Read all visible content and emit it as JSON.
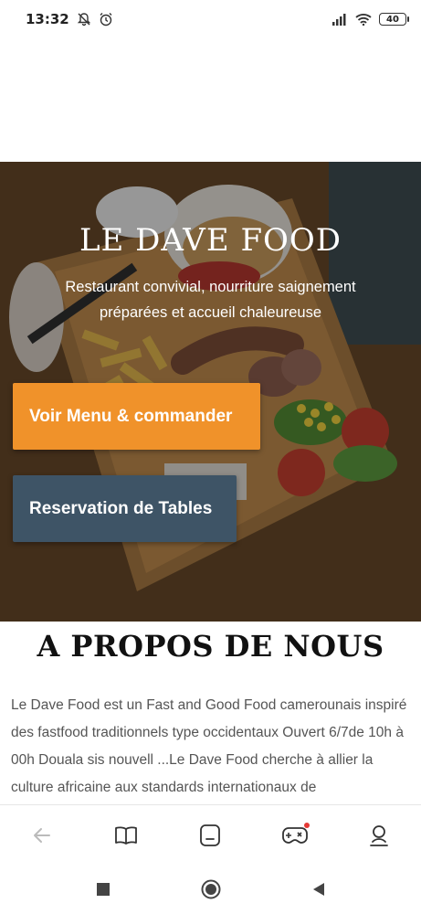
{
  "status_bar": {
    "time": "13:32",
    "battery": "40",
    "icons": [
      "notifications-off-icon",
      "alarm-icon",
      "signal-icon",
      "wifi-icon",
      "battery-icon"
    ]
  },
  "hero": {
    "title": "LE DAVE FOOD",
    "subtitle": "Restaurant convivial, nourriture saignement préparées et accueil chaleureuse",
    "menu_button": "Voir Menu & commander",
    "reservation_button": "Reservation de Tables",
    "colors": {
      "menu_button": "#f0922a",
      "reservation_button": "#3e5466"
    }
  },
  "about": {
    "title": "A PROPOS DE NOUS",
    "text": "Le Dave Food est un  Fast and Good Food camerounais inspiré des fastfood traditionnels type occidentaux Ouvert 6/7de 10h à 00h Douala sis nouvell ...Le Dave Food cherche à allier la culture africaine aux standards internationaux de"
  },
  "bottom_nav": {
    "items": [
      "back-icon",
      "bookmarks-icon",
      "tabs-icon",
      "games-icon",
      "profile-icon"
    ]
  },
  "system_nav": {
    "items": [
      "recents-icon",
      "home-icon",
      "back-triangle-icon"
    ]
  }
}
